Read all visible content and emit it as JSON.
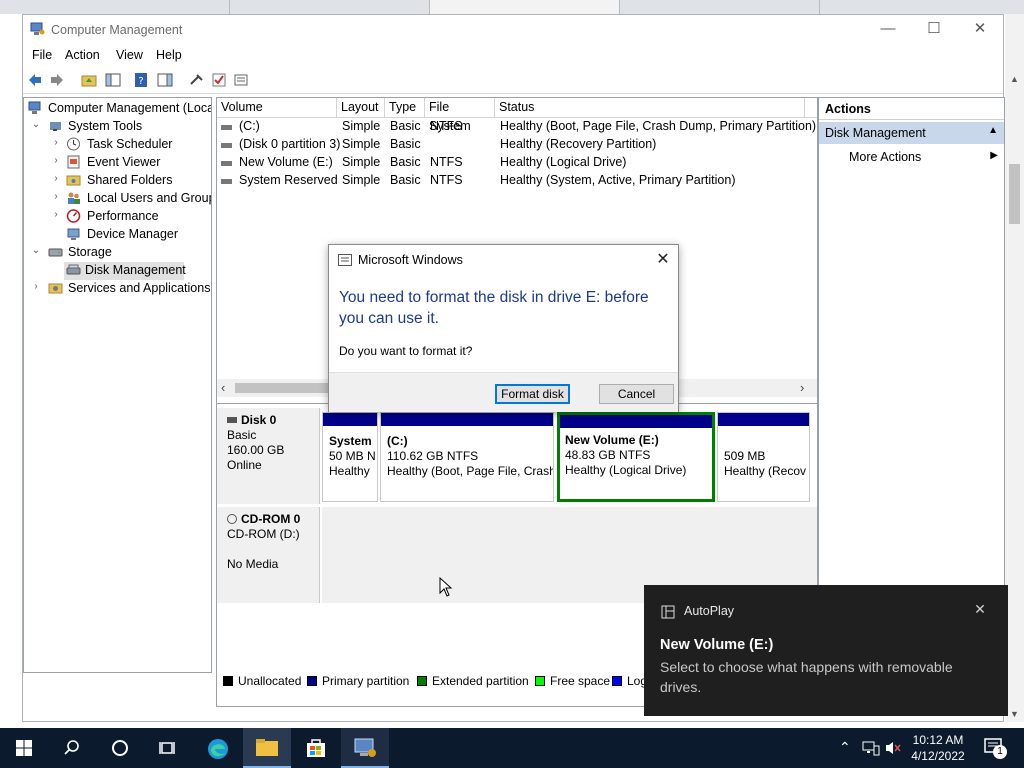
{
  "window": {
    "title": "Computer Management",
    "controls": {
      "minimize": "—",
      "maximize": "☐",
      "close": "✕"
    }
  },
  "menu": [
    "File",
    "Action",
    "View",
    "Help"
  ],
  "tree": {
    "root": "Computer Management (Local",
    "system_tools": "System Tools",
    "task_scheduler": "Task Scheduler",
    "event_viewer": "Event Viewer",
    "shared_folders": "Shared Folders",
    "local_users": "Local Users and Groups",
    "performance": "Performance",
    "device_manager": "Device Manager",
    "storage": "Storage",
    "disk_management": "Disk Management",
    "services": "Services and Applications"
  },
  "volumes": {
    "columns": [
      "Volume",
      "Layout",
      "Type",
      "File System",
      "Status"
    ],
    "rows": [
      {
        "volume": "(C:)",
        "layout": "Simple",
        "type": "Basic",
        "fs": "NTFS",
        "status": "Healthy (Boot, Page File, Crash Dump, Primary Partition)"
      },
      {
        "volume": "(Disk 0 partition 3)",
        "layout": "Simple",
        "type": "Basic",
        "fs": "",
        "status": "Healthy (Recovery Partition)"
      },
      {
        "volume": "New Volume (E:)",
        "layout": "Simple",
        "type": "Basic",
        "fs": "NTFS",
        "status": "Healthy (Logical Drive)"
      },
      {
        "volume": "System Reserved",
        "layout": "Simple",
        "type": "Basic",
        "fs": "NTFS",
        "status": "Healthy (System, Active, Primary Partition)"
      }
    ]
  },
  "disks": {
    "disk0": {
      "name": "Disk 0",
      "type": "Basic",
      "size": "160.00 GB",
      "state": "Online"
    },
    "partitions": [
      {
        "name": "System",
        "size": "50 MB N",
        "status": "Healthy"
      },
      {
        "name": "(C:)",
        "size": "110.62 GB NTFS",
        "status": "Healthy (Boot, Page File, Crash"
      },
      {
        "name": "New Volume  (E:)",
        "size": "48.83 GB NTFS",
        "status": "Healthy (Logical Drive)"
      },
      {
        "name": "",
        "size": "509 MB",
        "status": "Healthy (Recov"
      }
    ],
    "cdrom": {
      "name": "CD-ROM 0",
      "type": "CD-ROM (D:)",
      "state": "No Media"
    }
  },
  "legend": [
    {
      "label": "Unallocated",
      "color": "#000000"
    },
    {
      "label": "Primary partition",
      "color": "#00008b"
    },
    {
      "label": "Extended partition",
      "color": "#008000"
    },
    {
      "label": "Free space",
      "color": "#00ff00"
    },
    {
      "label": "Log",
      "color": "#0000ff"
    }
  ],
  "actions": {
    "header": "Actions",
    "selected": "Disk Management",
    "more": "More Actions"
  },
  "dialog": {
    "title": "Microsoft Windows",
    "message": "You need to format the disk in drive E: before you can use it.",
    "question": "Do you want to format it?",
    "format_button": "Format disk",
    "cancel_button": "Cancel"
  },
  "toast": {
    "app": "AutoPlay",
    "title": "New Volume (E:)",
    "body": "Select to choose what happens with removable drives."
  },
  "taskbar": {
    "time": "10:12 AM",
    "date": "4/12/2022",
    "notification_count": "1"
  },
  "colors": {
    "primary_partition": "#00008b",
    "selected_outline": "#008000",
    "dialog_heading": "#1c3a8c",
    "taskbar": "#0c1a2e"
  }
}
